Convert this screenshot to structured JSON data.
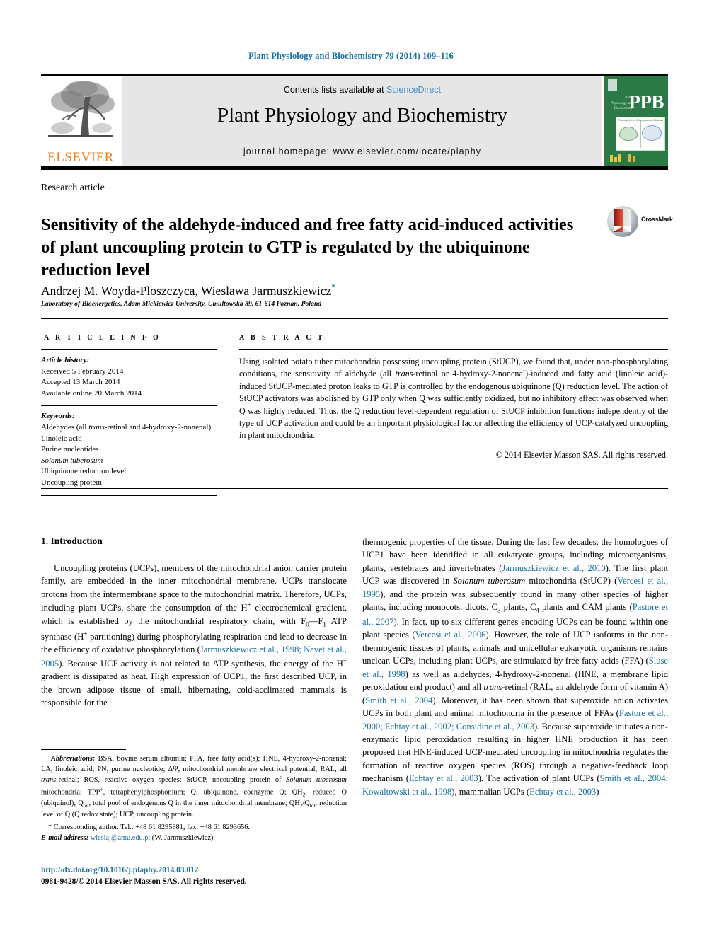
{
  "running_head": "Plant Physiology and Biochemistry 79 (2014) 109–116",
  "masthead": {
    "publisher_name": "ELSEVIER",
    "contents_prefix": "Contents lists available at ",
    "contents_link": "ScienceDirect",
    "journal_title": "Plant Physiology and Biochemistry",
    "homepage_line": "journal homepage: www.elsevier.com/locate/plaphy",
    "cover_abbrev": "PPB",
    "cover_subtitle": "Plant Physiology and Biochemistry",
    "cover_fig_left_label": "Photosynthesis",
    "cover_fig_right_label": "Chloroplast and Nucleus"
  },
  "article": {
    "type": "Research article",
    "title": "Sensitivity of the aldehyde-induced and free fatty acid-induced activities of plant uncoupling protein to GTP is regulated by the ubiquinone reduction level",
    "authors": "Andrzej M. Woyda-Ploszczyca, Wieslawa Jarmuszkiewicz",
    "corresponding_marker": "*",
    "affiliation": "Laboratory of Bioenergetics, Adam Mickiewicz University, Umultowska 89, 61-614 Poznan, Poland",
    "crossmark_label": "CrossMark"
  },
  "info": {
    "heading": "A R T I C L E   I N F O",
    "history_label": "Article history:",
    "history": [
      "Received 5 February 2014",
      "Accepted 13 March 2014",
      "Available online 20 March 2014"
    ],
    "keywords_label": "Keywords:",
    "keywords": [
      "Aldehydes (all trans-retinal and 4-hydroxy-2-nonenal)",
      "Linoleic acid",
      "Purine nucleotides",
      "Solanum tuberosum",
      "Ubiquinone reduction level",
      "Uncoupling protein"
    ]
  },
  "abstract": {
    "heading": "A B S T R A C T",
    "text": "Using isolated potato tuber mitochondria possessing uncoupling protein (StUCP), we found that, under non-phosphorylating conditions, the sensitivity of aldehyde (all trans-retinal or 4-hydroxy-2-nonenal)-induced and fatty acid (linoleic acid)-induced StUCP-mediated proton leaks to GTP is controlled by the endogenous ubiquinone (Q) reduction level. The action of StUCP activators was abolished by GTP only when Q was sufficiently oxidized, but no inhibitory effect was observed when Q was highly reduced. Thus, the Q reduction level-dependent regulation of StUCP inhibition functions independently of the type of UCP activation and could be an important physiological factor affecting the efficiency of UCP-catalyzed uncoupling in plant mitochondria.",
    "copyright": "© 2014 Elsevier Masson SAS. All rights reserved."
  },
  "body": {
    "section_number_title": "1. Introduction",
    "left_paragraph": "Uncoupling proteins (UCPs), members of the mitochondrial anion carrier protein family, are embedded in the inner mitochondrial membrane. UCPs translocate protons from the intermembrane space to the mitochondrial matrix. Therefore, UCPs, including plant UCPs, share the consumption of the H+ electrochemical gradient, which is established by the mitochondrial respiratory chain, with F0–F1 ATP synthase (H+ partitioning) during phosphorylating respiration and lead to decrease in the efficiency of oxidative phosphorylation (Jarmuszkiewicz et al., 1998; Navet et al., 2005). Because UCP activity is not related to ATP synthesis, the energy of the H+ gradient is dissipated as heat. High expression of UCP1, the first described UCP, in the brown adipose tissue of small, hibernating, cold-acclimated mammals is responsible for the",
    "right_paragraph": "thermogenic properties of the tissue. During the last few decades, the homologues of UCP1 have been identified in all eukaryote groups, including microorganisms, plants, vertebrates and invertebrates (Jarmuszkiewicz et al., 2010). The first plant UCP was discovered in Solanum tuberosum mitochondria (StUCP) (Vercesi et al., 1995), and the protein was subsequently found in many other species of higher plants, including monocots, dicots, C3 plants, C4 plants and CAM plants (Pastore et al., 2007). In fact, up to six different genes encoding UCPs can be found within one plant species (Vercesi et al., 2006). However, the role of UCP isoforms in the non-thermogenic tissues of plants, animals and unicellular eukaryotic organisms remains unclear. UCPs, including plant UCPs, are stimulated by free fatty acids (FFA) (Sluse et al., 1998) as well as aldehydes, 4-hydroxy-2-nonenal (HNE, a membrane lipid peroxidation end product) and all trans-retinal (RAL, an aldehyde form of vitamin A) (Smith et al., 2004). Moreover, it has been shown that superoxide anion activates UCPs in both plant and animal mitochondria in the presence of FFAs (Pastore et al., 2000; Echtay et al., 2002; Considine et al., 2003). Because superoxide initiates a non-enzymatic lipid peroxidation resulting in higher HNE production it has been proposed that HNE-induced UCP-mediated uncoupling in mitochondria regulates the formation of reactive oxygen species (ROS) through a negative-feedback loop mechanism (Echtay et al., 2003). The activation of plant UCPs (Smith et al., 2004; Kowaltowski et al., 1998), mammalian UCPs (Echtay et al., 2003)",
    "references_inline": [
      "Jarmuszkiewicz et al., 1998; Navet et al., 2005",
      "Jarmuszkiewicz et al., 2010",
      "Vercesi et al., 1995",
      "Pastore et al., 2007",
      "Vercesi et al., 2006",
      "Sluse et al., 1998",
      "Smith et al., 2004",
      "Pastore et al., 2000; Echtay et al., 2002; Considine et al., 2003",
      "Echtay et al., 2003",
      "Smith et al., 2004; Kowaltowski et al., 1998",
      "Echtay et al., 2003"
    ]
  },
  "footnotes": {
    "abbreviations_label": "Abbreviations:",
    "abbreviations_text": "BSA, bovine serum albumin; FFA, free fatty acid(s); HNE, 4-hydroxy-2-nonenal; LA, linoleic acid; PN, purine nucleotide; ΔΨ, mitochondrial membrane electrical potential; RAL, all trans-retinal; ROS, reactive oxygen species; StUCP, uncoupling protein of Solanum tuberosum mitochondria; TPP+, tetraphenylphosphonium; Q, ubiquinone, coenzyme Q; QH2, reduced Q (ubiquinol); Qtot, total pool of endogenous Q in the inner mitochondrial membrane; QH2/Qtot, reduction level of Q (Q redox state); UCP, uncoupling protein.",
    "corresponding": "* Corresponding author. Tel.: +48 61 8295881; fax: +48 61 8293656.",
    "email_label": "E-mail address:",
    "email": "wiesiaj@amu.edu.pl",
    "email_suffix": "(W. Jarmuszkiewicz).",
    "doi": "http://dx.doi.org/10.1016/j.plaphy.2014.03.012",
    "issn_line": "0981-9428/© 2014 Elsevier Masson SAS. All rights reserved."
  },
  "colors": {
    "link": "#1670a0",
    "sciencedirect": "#4a90c4",
    "elsevier_orange": "#f07f1a",
    "ppb_green": "#2b7a45",
    "contents_bg": "#e6e6e6"
  }
}
